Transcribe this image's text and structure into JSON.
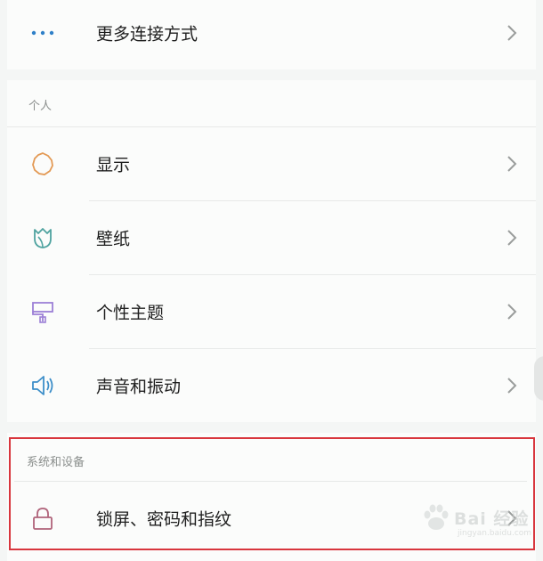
{
  "top_section": {
    "more_connections": {
      "label": "更多连接方式",
      "icon": "more-dots-icon"
    }
  },
  "personal": {
    "header": "个人",
    "items": [
      {
        "label": "显示",
        "icon": "sun-icon",
        "color": "#e39a55"
      },
      {
        "label": "壁纸",
        "icon": "tulip-icon",
        "color": "#4fa3a0"
      },
      {
        "label": "个性主题",
        "icon": "paint-roller-icon",
        "color": "#9c7fd6"
      },
      {
        "label": "声音和振动",
        "icon": "speaker-icon",
        "color": "#3e8fc9"
      }
    ]
  },
  "system": {
    "header": "系统和设备",
    "items": [
      {
        "label": "锁屏、密码和指纹",
        "icon": "lock-icon",
        "color": "#b0637a"
      }
    ]
  },
  "watermark": {
    "text": "Bai 经验",
    "sub": "jingyan.baidu.com"
  },
  "colors": {
    "background": "#f4f6f5",
    "card": "#fbfcfb",
    "highlight_box": "#d8363d",
    "chevron": "#9a9d9c"
  }
}
